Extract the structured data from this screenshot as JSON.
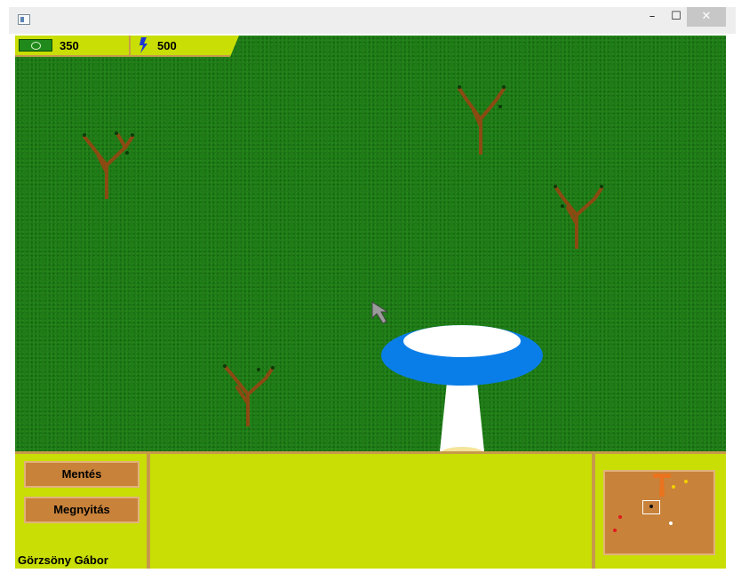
{
  "window": {
    "minimize_glyph": "–",
    "maximize_glyph": "☐",
    "close_glyph": "✕"
  },
  "hud": {
    "money_value": "350",
    "energy_value": "500",
    "money_icon": "money-bill-icon",
    "energy_icon": "lightning-bolt-icon"
  },
  "bottom_panel": {
    "save_label": "Mentés",
    "open_label": "Megnyitás",
    "author": "Görzsöny Gábor"
  },
  "colors": {
    "grass": "#217a18",
    "panel": "#c8de05",
    "panel_border": "#c79a4a",
    "button": "#c8823a",
    "ufo_rim": "#0a7ee8",
    "ufo_top": "#ffffff"
  }
}
